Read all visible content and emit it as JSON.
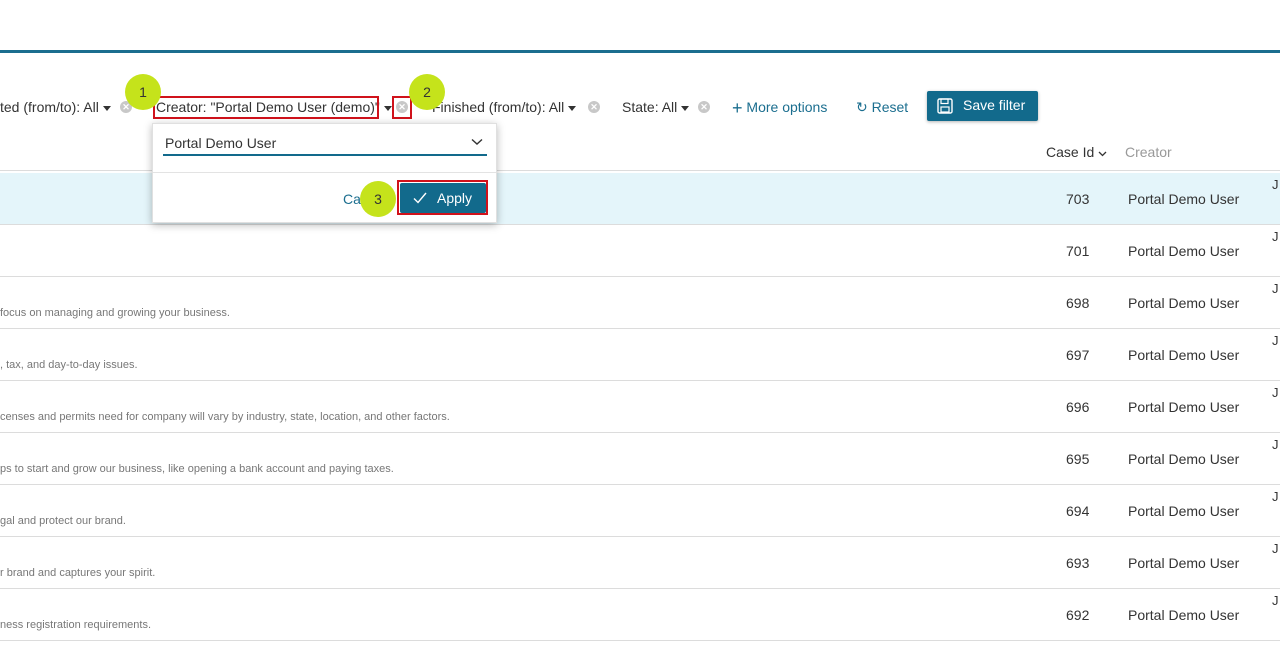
{
  "filters": {
    "created_label": "ted (from/to): All",
    "creator_label": "Creator: \"Portal Demo User (demo)\"",
    "finished_label": "Finished (from/to): All",
    "state_label": "State: All",
    "more_options": "More options",
    "reset": "Reset",
    "save_filter": "Save filter"
  },
  "badges": [
    "1",
    "2",
    "3"
  ],
  "dropdown": {
    "selected": "Portal Demo User",
    "cancel": "Ca",
    "apply": "Apply"
  },
  "table": {
    "headers": {
      "case_id": "Case Id",
      "creator": "Creator"
    },
    "rows": [
      {
        "case_id": "703",
        "creator": "Portal Demo User",
        "desc": "",
        "trail": "J"
      },
      {
        "case_id": "701",
        "creator": "Portal Demo User",
        "desc": "",
        "trail": "J"
      },
      {
        "case_id": "698",
        "creator": "Portal Demo User",
        "desc": "focus on managing and growing your business.",
        "trail": "J"
      },
      {
        "case_id": "697",
        "creator": "Portal Demo User",
        "desc": ", tax, and day-to-day issues.",
        "trail": "J"
      },
      {
        "case_id": "696",
        "creator": "Portal Demo User",
        "desc": "censes and permits need for company will vary by industry, state, location, and other factors.",
        "trail": "J"
      },
      {
        "case_id": "695",
        "creator": "Portal Demo User",
        "desc": "ps to start and grow our business, like opening a bank account and paying taxes.",
        "trail": "J"
      },
      {
        "case_id": "694",
        "creator": "Portal Demo User",
        "desc": "gal and protect our brand.",
        "trail": "J"
      },
      {
        "case_id": "693",
        "creator": "Portal Demo User",
        "desc": "r brand and captures your spirit.",
        "trail": "J"
      },
      {
        "case_id": "692",
        "creator": "Portal Demo User",
        "desc": "ness registration requirements.",
        "trail": "J"
      }
    ]
  },
  "colors": {
    "primary": "#126a8c",
    "highlight": "#d0121b",
    "badge": "#c5e31b",
    "selected_row": "#e4f5fa"
  }
}
